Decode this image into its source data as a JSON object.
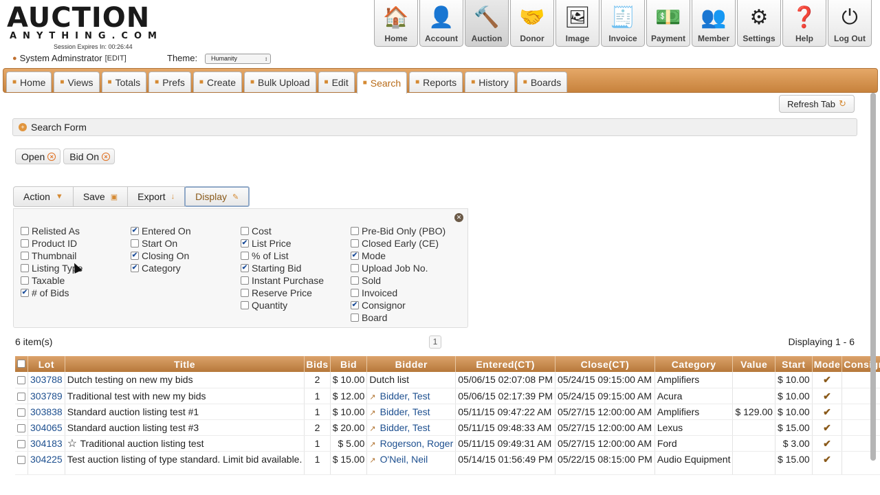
{
  "header": {
    "logo_main": "AUCTION",
    "logo_sub": "ANYTHING.COM",
    "session": "Session Expires In: 00:26:44",
    "user": "System Adminstrator",
    "edit": "[EDIT]",
    "theme_label": "Theme:",
    "theme_value": "Humanity"
  },
  "topnav": [
    {
      "label": "Home",
      "icon": "house-icon",
      "glyph": "🏠"
    },
    {
      "label": "Account",
      "icon": "account-icon",
      "glyph": "👤"
    },
    {
      "label": "Auction",
      "icon": "gavel-icon",
      "glyph": "🔨"
    },
    {
      "label": "Donor",
      "icon": "handshake-icon",
      "glyph": "🤝"
    },
    {
      "label": "Image",
      "icon": "image-icon",
      "glyph": "🖼"
    },
    {
      "label": "Invoice",
      "icon": "invoice-icon",
      "glyph": "🧾"
    },
    {
      "label": "Payment",
      "icon": "payment-icon",
      "glyph": "💵"
    },
    {
      "label": "Member",
      "icon": "members-icon",
      "glyph": "👥"
    },
    {
      "label": "Settings",
      "icon": "gear-icon",
      "glyph": "⚙"
    },
    {
      "label": "Help",
      "icon": "help-icon",
      "glyph": "❓"
    },
    {
      "label": "Log Out",
      "icon": "power-icon",
      "glyph": "⏻"
    }
  ],
  "tabs": [
    {
      "label": "Home",
      "icon": "home-icon"
    },
    {
      "label": "Views",
      "icon": "views-icon"
    },
    {
      "label": "Totals",
      "icon": "bar-chart-icon"
    },
    {
      "label": "Prefs",
      "icon": "gear-icon"
    },
    {
      "label": "Create",
      "icon": "star-icon"
    },
    {
      "label": "Bulk Upload",
      "icon": "upload-icon"
    },
    {
      "label": "Edit",
      "icon": "pencil-icon"
    },
    {
      "label": "Search",
      "icon": "search-icon"
    },
    {
      "label": "Reports",
      "icon": "document-icon"
    },
    {
      "label": "History",
      "icon": "history-icon"
    },
    {
      "label": "Boards",
      "icon": "board-icon"
    }
  ],
  "refresh_label": "Refresh Tab",
  "search_form_label": "Search Form",
  "filters": [
    "Open",
    "Bid On"
  ],
  "toolbar": {
    "action": "Action",
    "save": "Save",
    "export": "Export",
    "display": "Display"
  },
  "display_options": [
    [
      {
        "label": "Relisted As",
        "checked": false
      },
      {
        "label": "Product ID",
        "checked": false
      },
      {
        "label": "Thumbnail",
        "checked": false
      },
      {
        "label": "Listing Type",
        "checked": false
      },
      {
        "label": "Taxable",
        "checked": false
      },
      {
        "label": "# of Bids",
        "checked": true
      }
    ],
    [
      {
        "label": "Entered On",
        "checked": true
      },
      {
        "label": "Start On",
        "checked": false
      },
      {
        "label": "Closing On",
        "checked": true
      },
      {
        "label": "Category",
        "checked": true
      }
    ],
    [
      {
        "label": "Cost",
        "checked": false
      },
      {
        "label": "List Price",
        "checked": true
      },
      {
        "label": "% of List",
        "checked": false
      },
      {
        "label": "Starting Bid",
        "checked": true
      },
      {
        "label": "Instant Purchase",
        "checked": false
      },
      {
        "label": "Reserve Price",
        "checked": false
      },
      {
        "label": "Quantity",
        "checked": false
      }
    ],
    [
      {
        "label": "Pre-Bid Only (PBO)",
        "checked": false
      },
      {
        "label": "Closed Early (CE)",
        "checked": false
      },
      {
        "label": "Mode",
        "checked": true
      },
      {
        "label": "Upload Job No.",
        "checked": false
      },
      {
        "label": "Sold",
        "checked": false
      },
      {
        "label": "Invoiced",
        "checked": false
      },
      {
        "label": "Consignor",
        "checked": true
      },
      {
        "label": "Board",
        "checked": false
      }
    ]
  ],
  "summary": {
    "count": "6 item(s)",
    "page": "1",
    "displaying": "Displaying 1 - 6"
  },
  "table": {
    "columns": [
      "Lot",
      "Title",
      "Bids",
      "Bid",
      "Bidder",
      "Entered(CT)",
      "Close(CT)",
      "Category",
      "Value",
      "Start",
      "Mode",
      "Consignor"
    ],
    "rows": [
      {
        "lot": "303788",
        "title": "Dutch testing on new my bids",
        "bids": "2",
        "bid": "$ 10.00",
        "bidder": "Dutch list",
        "bidder_link": false,
        "entered": "05/06/15 02:07:08 PM",
        "close": "05/24/15 09:15:00 AM",
        "category": "Amplifiers",
        "value": "",
        "start": "$ 10.00",
        "mode": "✔",
        "consignor": "",
        "star": false
      },
      {
        "lot": "303789",
        "title": "Traditional test with new my bids",
        "bids": "1",
        "bid": "$ 12.00",
        "bidder": "Bidder, Test",
        "bidder_link": true,
        "entered": "05/06/15 02:17:39 PM",
        "close": "05/24/15 09:15:00 AM",
        "category": "Acura",
        "value": "",
        "start": "$ 10.00",
        "mode": "✔",
        "consignor": "",
        "star": false
      },
      {
        "lot": "303838",
        "title": "Standard auction listing test #1",
        "bids": "1",
        "bid": "$ 10.00",
        "bidder": "Bidder, Test",
        "bidder_link": true,
        "entered": "05/11/15 09:47:22 AM",
        "close": "05/27/15 12:00:00 AM",
        "category": "Amplifiers",
        "value": "$ 129.00",
        "start": "$ 10.00",
        "mode": "✔",
        "consignor": "",
        "star": false
      },
      {
        "lot": "304065",
        "title": "Standard auction listing test #3",
        "bids": "2",
        "bid": "$ 20.00",
        "bidder": "Bidder, Test",
        "bidder_link": true,
        "entered": "05/11/15 09:48:33 AM",
        "close": "05/27/15 12:00:00 AM",
        "category": "Lexus",
        "value": "",
        "start": "$ 15.00",
        "mode": "✔",
        "consignor": "",
        "star": false
      },
      {
        "lot": "304183",
        "title": "Traditional auction listing test",
        "bids": "1",
        "bid": "$ 5.00",
        "bidder": "Rogerson, Roger",
        "bidder_link": true,
        "entered": "05/11/15 09:49:31 AM",
        "close": "05/27/15 12:00:00 AM",
        "category": "Ford",
        "value": "",
        "start": "$ 3.00",
        "mode": "✔",
        "consignor": "",
        "star": true
      },
      {
        "lot": "304225",
        "title": "Test auction listing of type standard. Limit bid available.",
        "bids": "1",
        "bid": "$ 15.00",
        "bidder": "O'Neil, Neil",
        "bidder_link": true,
        "entered": "05/14/15 01:56:49 PM",
        "close": "05/22/15 08:15:00 PM",
        "category": "Audio Equipment",
        "value": "",
        "start": "$ 15.00",
        "mode": "✔",
        "consignor": "",
        "star": false
      }
    ]
  }
}
